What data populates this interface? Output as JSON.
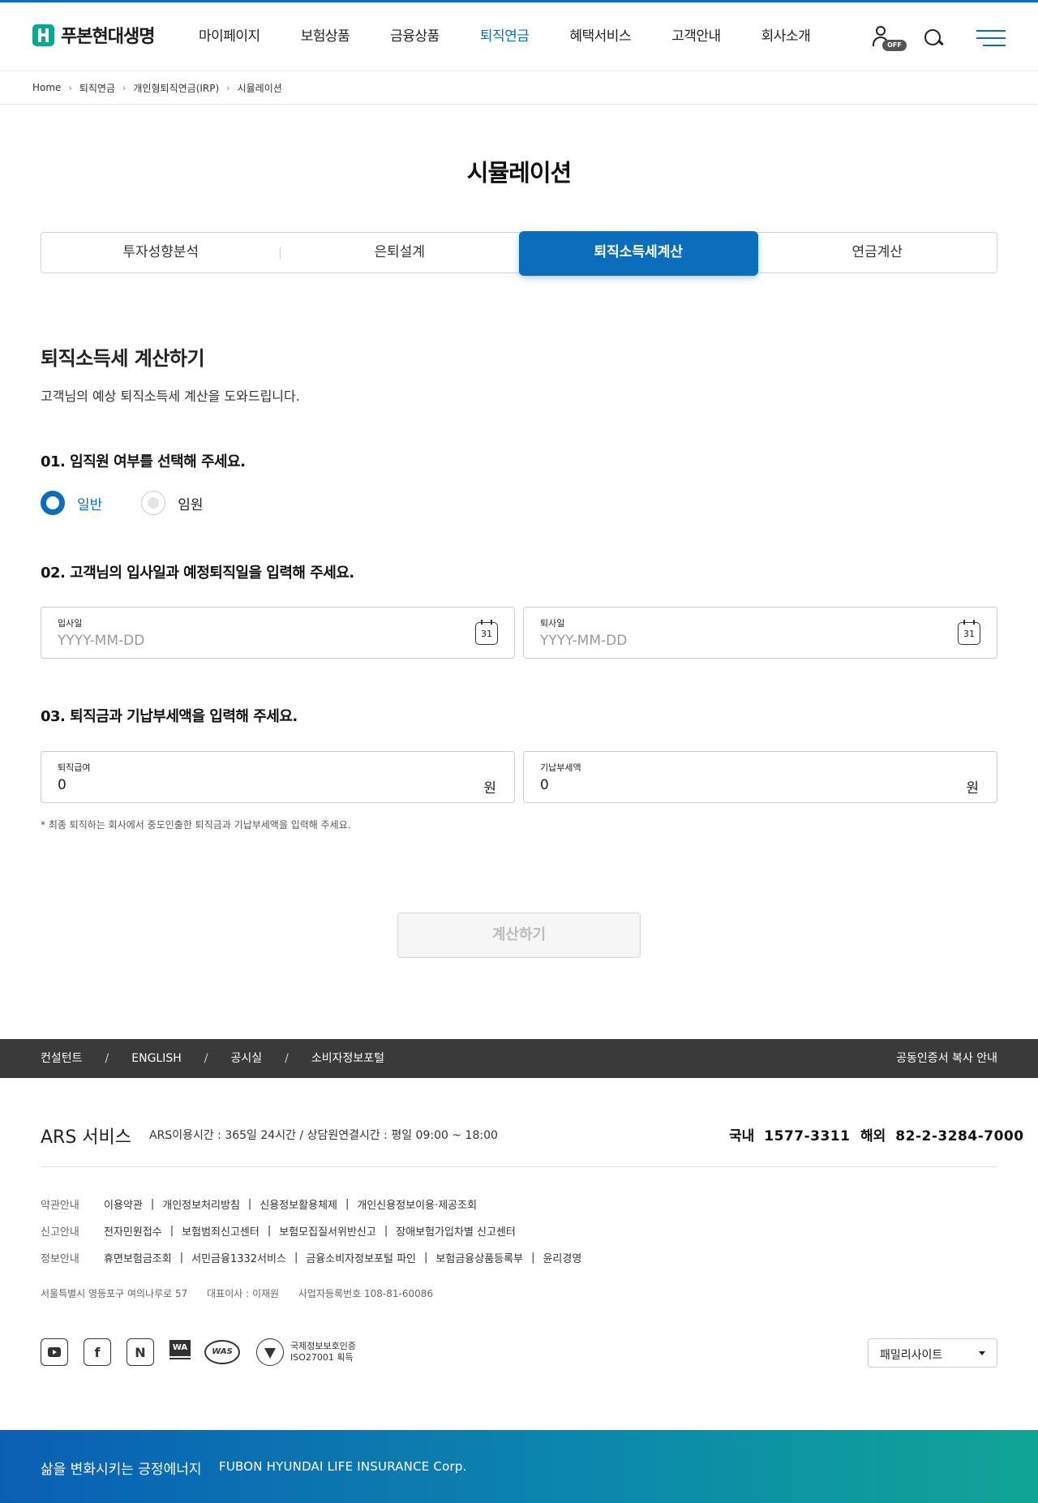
{
  "header": {
    "logo_text": "푸본현대생명",
    "nav": [
      "마이페이지",
      "보험상품",
      "금융상품",
      "퇴직연금",
      "혜택서비스",
      "고객안내",
      "회사소개"
    ],
    "active_nav": "퇴직연금",
    "user_badge": "OFF"
  },
  "breadcrumb": [
    "Home",
    "퇴직연금",
    "개인형퇴직연금(IRP)",
    "시뮬레이션"
  ],
  "page_title": "시뮬레이션",
  "tabs": [
    "투자성향분석",
    "은퇴설계",
    "퇴직소득세계산",
    "연금계산"
  ],
  "active_tab": "퇴직소득세계산",
  "section": {
    "title": "퇴직소득세 계산하기",
    "desc": "고객님의 예상 퇴직소득세 계산을 도와드립니다."
  },
  "q1": {
    "title": "01. 임직원 여부를 선택해 주세요.",
    "options": [
      "일반",
      "임원"
    ],
    "selected": "일반"
  },
  "q2": {
    "title": "02. 고객님의 입사일과 예정퇴직일을 입력해 주세요.",
    "join_label": "입사일",
    "join_placeholder": "YYYY-MM-DD",
    "leave_label": "퇴사일",
    "leave_placeholder": "YYYY-MM-DD",
    "calendar_day": "31"
  },
  "q3": {
    "title": "03. 퇴직금과 기납부세액을 입력해 주세요.",
    "pay_label": "퇴직급여",
    "pay_value": "0",
    "tax_label": "기납부세액",
    "tax_value": "0",
    "unit": "원",
    "note": "* 최종 퇴직하는 회사에서 중도인출한 퇴직금과 기납부세액을 입력해 주세요."
  },
  "calc_button": "계산하기",
  "footer": {
    "bar_links": [
      "컨설턴트",
      "ENGLISH",
      "공시실",
      "소비자정보포털"
    ],
    "bar_sep": "/",
    "cert_link": "공동인증서 복사 안내",
    "ars_title": "ARS 서비스",
    "ars_desc": "ARS이용시간 : 365일 24시간 / 상담원연결시간 : 평일 09:00 ~ 18:00",
    "domestic_label": "국내",
    "domestic_number": "1577-3311",
    "overseas_label": "해외",
    "overseas_number": "82-2-3284-7000",
    "rows": [
      {
        "cat": "약관안내",
        "items": [
          "이용약관",
          "개인정보처리방침",
          "신용정보활용체제",
          "개인신용정보이용·제공조회"
        ]
      },
      {
        "cat": "신고안내",
        "items": [
          "전자민원접수",
          "보험범죄신고센터",
          "보험모집질서위반신고",
          "장애보험가입차별 신고센터"
        ]
      },
      {
        "cat": "정보안내",
        "items": [
          "휴면보험금조회",
          "서민금융1332서비스",
          "금융소비자정보포털 파인",
          "보험금융상품등록부",
          "윤리경영"
        ]
      }
    ],
    "address": "서울특별시 영등포구 여의나루로 57",
    "ceo": "대표이사 : 이재원",
    "biz_no": "사업자등록번호 108-81-60086",
    "isms_line1": "국제정보보호인증",
    "isms_line2": "ISO27001 획득",
    "family_site": "패밀리사이트",
    "slogan": "삶을 변화시키는 긍정에너지",
    "corp": "FUBON HYUNDAI LIFE INSURANCE Corp."
  },
  "colors": {
    "accent": "#0a6ebd",
    "footer_bar": "#3a3a3a",
    "gradient_start": "#0a5fb4",
    "gradient_end": "#10a595"
  }
}
